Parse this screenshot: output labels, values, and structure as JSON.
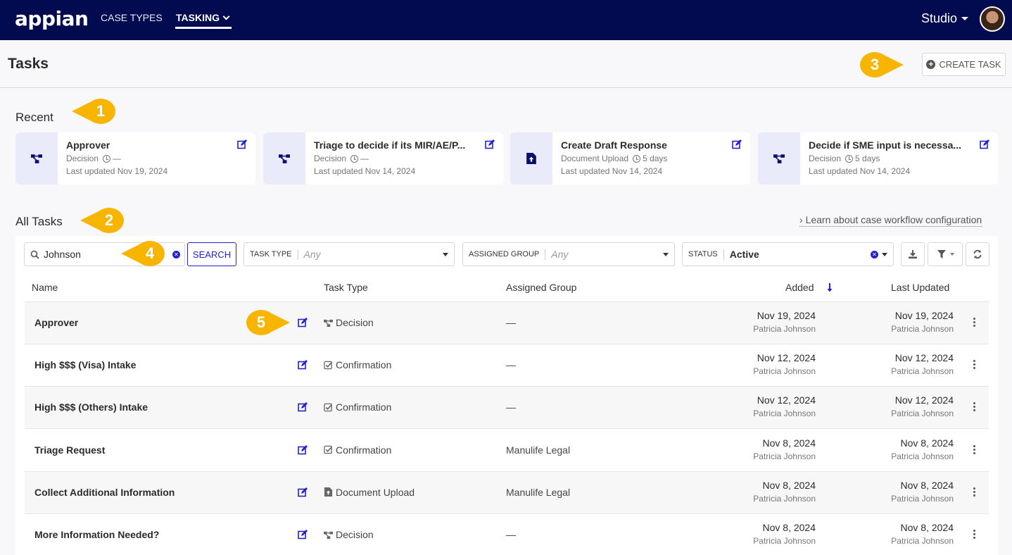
{
  "header": {
    "logo": "appian",
    "nav": [
      {
        "label": "CASE TYPES",
        "active": false
      },
      {
        "label": "TASKING",
        "active": true
      }
    ],
    "workspace_label": "Studio"
  },
  "page": {
    "title": "Tasks",
    "create_button_label": "CREATE TASK"
  },
  "callouts": [
    "1",
    "2",
    "3",
    "4",
    "5"
  ],
  "recent": {
    "label": "Recent",
    "cards": [
      {
        "title": "Approver",
        "type": "Decision",
        "duration": "—",
        "updated": "Last updated Nov 19, 2024",
        "icon": "decision-icon"
      },
      {
        "title": "Triage to decide if its MIR/AE/P...",
        "type": "Decision",
        "duration": "—",
        "updated": "Last updated Nov 14, 2024",
        "icon": "decision-icon"
      },
      {
        "title": "Create Draft Response",
        "type": "Document Upload",
        "duration": "5 days",
        "updated": "Last updated Nov 14, 2024",
        "icon": "document-upload-icon"
      },
      {
        "title": "Decide if SME input is necessa...",
        "type": "Decision",
        "duration": "5 days",
        "updated": "Last updated Nov 14, 2024",
        "icon": "decision-icon"
      }
    ]
  },
  "all_tasks": {
    "label": "All Tasks",
    "learn_link": "Learn about case workflow configuration",
    "search": {
      "value": "Johnson",
      "button_label": "SEARCH"
    },
    "filters": [
      {
        "label": "TASK TYPE",
        "value": "Any",
        "placeholder": true
      },
      {
        "label": "ASSIGNED GROUP",
        "value": "Any",
        "placeholder": true
      },
      {
        "label": "STATUS",
        "value": "Active",
        "placeholder": false
      }
    ],
    "columns": [
      "Name",
      "Task Type",
      "Assigned Group",
      "Added",
      "Last Updated"
    ],
    "sort": {
      "column": "Added",
      "direction": "descending"
    },
    "rows": [
      {
        "name": "Approver",
        "type": "Decision",
        "type_icon": "decision-icon",
        "group": "—",
        "added": "Nov 19, 2024",
        "added_by": "Patricia Johnson",
        "updated": "Nov 19, 2024",
        "updated_by": "Patricia Johnson"
      },
      {
        "name": "High $$$ (Visa) Intake",
        "type": "Confirmation",
        "type_icon": "checkbox-icon",
        "group": "—",
        "added": "Nov 12, 2024",
        "added_by": "Patricia Johnson",
        "updated": "Nov 12, 2024",
        "updated_by": "Patricia Johnson"
      },
      {
        "name": "High $$$ (Others) Intake",
        "type": "Confirmation",
        "type_icon": "checkbox-icon",
        "group": "—",
        "added": "Nov 12, 2024",
        "added_by": "Patricia Johnson",
        "updated": "Nov 12, 2024",
        "updated_by": "Patricia Johnson"
      },
      {
        "name": "Triage Request",
        "type": "Confirmation",
        "type_icon": "checkbox-icon",
        "group": "Manulife Legal",
        "added": "Nov 8, 2024",
        "added_by": "Patricia Johnson",
        "updated": "Nov 8, 2024",
        "updated_by": "Patricia Johnson"
      },
      {
        "name": "Collect Additional Information",
        "type": "Document Upload",
        "type_icon": "document-upload-icon",
        "group": "Manulife Legal",
        "added": "Nov 8, 2024",
        "added_by": "Patricia Johnson",
        "updated": "Nov 8, 2024",
        "updated_by": "Patricia Johnson"
      },
      {
        "name": "More Information Needed?",
        "type": "Decision",
        "type_icon": "decision-icon",
        "group": "—",
        "added": "Nov 8, 2024",
        "added_by": "Patricia Johnson",
        "updated": "Nov 8, 2024",
        "updated_by": "Patricia Johnson"
      }
    ]
  },
  "colors": {
    "header_bg": "#020a50",
    "accent": "#2322c9",
    "callout": "#f7b500",
    "card_icon_bg": "#e9ebfb"
  }
}
